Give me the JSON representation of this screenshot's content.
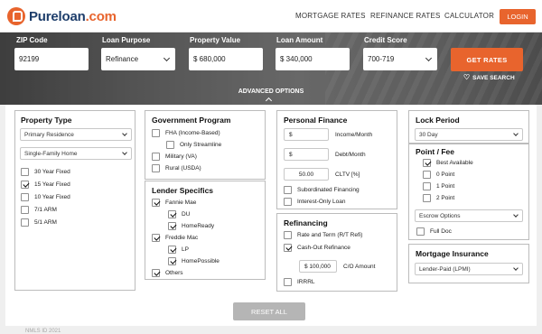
{
  "brand": {
    "name": "Pureloan",
    "suffix": ".com"
  },
  "nav": {
    "links": [
      "MORTGAGE RATES",
      "REFINANCE RATES",
      "CALCULATOR"
    ],
    "login": "LOGIN"
  },
  "search": {
    "zip": {
      "label": "ZIP Code",
      "value": "92199"
    },
    "purpose": {
      "label": "Loan Purpose",
      "value": "Refinance"
    },
    "property_value": {
      "label": "Property Value",
      "value": "$ 680,000"
    },
    "loan_amount": {
      "label": "Loan Amount",
      "value": "$ 340,000"
    },
    "credit": {
      "label": "Credit Score",
      "value": "700-719"
    },
    "get_rates": "GET RATES",
    "save_search": "SAVE SEARCH",
    "advanced": "ADVANCED OPTIONS"
  },
  "property_type": {
    "title": "Property Type",
    "residence": "Primary Residence",
    "home": "Single-Family Home",
    "terms": [
      {
        "label": "30 Year Fixed",
        "checked": false
      },
      {
        "label": "15 Year Fixed",
        "checked": true
      },
      {
        "label": "10 Year Fixed",
        "checked": false
      },
      {
        "label": "7/1 ARM",
        "checked": false
      },
      {
        "label": "5/1 ARM",
        "checked": false
      }
    ]
  },
  "government": {
    "title": "Government Program",
    "items": [
      "FHA (Income-Based)",
      "Only Streamline",
      "Military (VA)",
      "Rural (USDA)"
    ]
  },
  "lender": {
    "title": "Lender Specifics",
    "items": [
      "Fannie Mae",
      "DU",
      "HomeReady",
      "Freddie Mac",
      "LP",
      "HomePossible",
      "Others"
    ]
  },
  "personal": {
    "title": "Personal Finance",
    "income_prefix": "$",
    "income_label": "Income/Month",
    "debt_prefix": "$",
    "debt_label": "Debt/Month",
    "cltv_value": "50.00",
    "cltv_label": "CLTV [%]",
    "options": [
      "Subordinated Financing",
      "Interest-Only Loan"
    ]
  },
  "refinancing": {
    "title": "Refinancing",
    "options": [
      "Rate and Term (R/T Refi)",
      "Cash-Out Refinance"
    ],
    "co_value": "$ 100,000",
    "co_label": "C/O Amount",
    "irrrl": "IRRRL"
  },
  "lock": {
    "title": "Lock Period",
    "value": "30 Day"
  },
  "points": {
    "title": "Point / Fee",
    "options": [
      "Best Available",
      "0 Point",
      "1 Point",
      "2 Point"
    ],
    "escrow": "Escrow Options",
    "full_doc": "Full Doc"
  },
  "mi": {
    "title": "Mortgage Insurance",
    "value": "Lender-Paid (LPMI)"
  },
  "reset": "RESET ALL",
  "footnote": "NMLS ID 2021",
  "colors": {
    "accent": "#e8642d",
    "brand_dark": "#1e3e6b"
  }
}
